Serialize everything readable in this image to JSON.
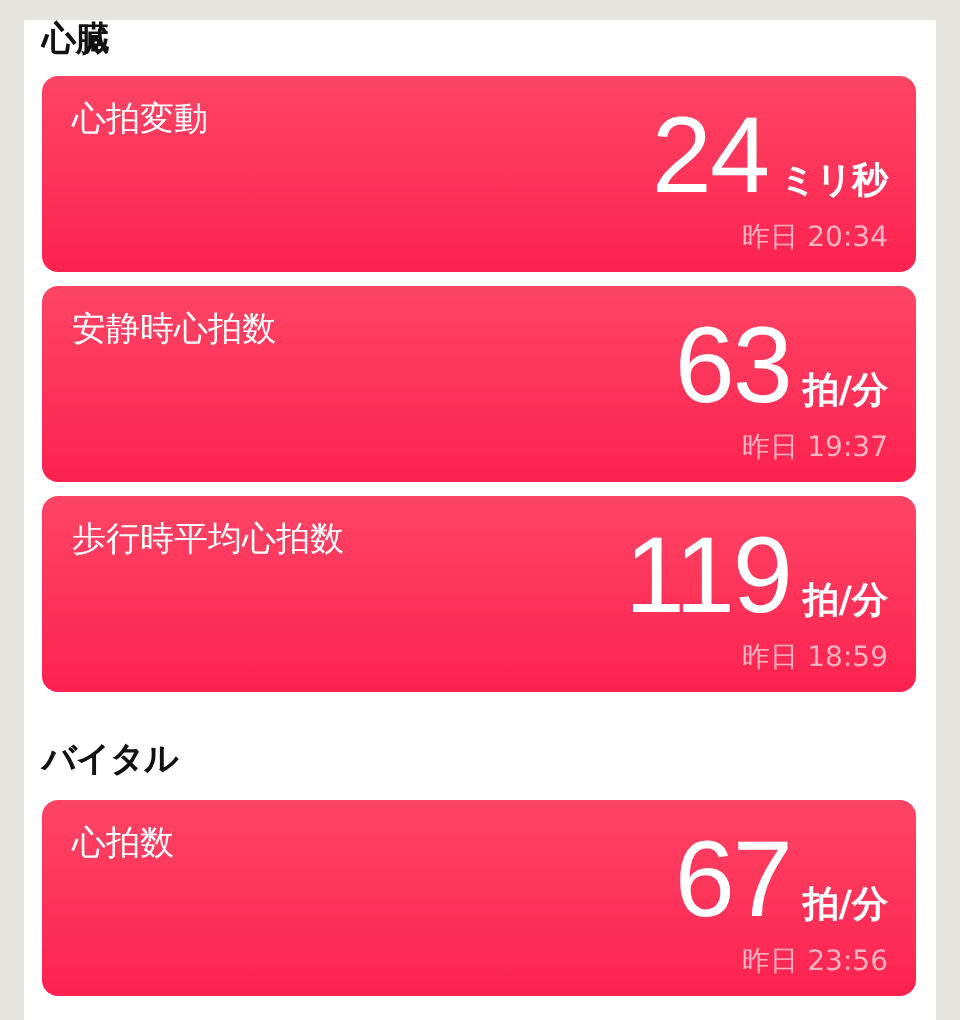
{
  "sections": [
    {
      "title": "心臓",
      "cards": [
        {
          "label": "心拍変動",
          "value": "24",
          "unit": "ミリ秒",
          "time": "昨日 20:34"
        },
        {
          "label": "安静時心拍数",
          "value": "63",
          "unit": "拍/分",
          "time": "昨日 19:37"
        },
        {
          "label": "歩行時平均心拍数",
          "value": "119",
          "unit": "拍/分",
          "time": "昨日 18:59"
        }
      ]
    },
    {
      "title": "バイタル",
      "cards": [
        {
          "label": "心拍数",
          "value": "67",
          "unit": "拍/分",
          "time": "昨日 23:56"
        }
      ]
    }
  ]
}
